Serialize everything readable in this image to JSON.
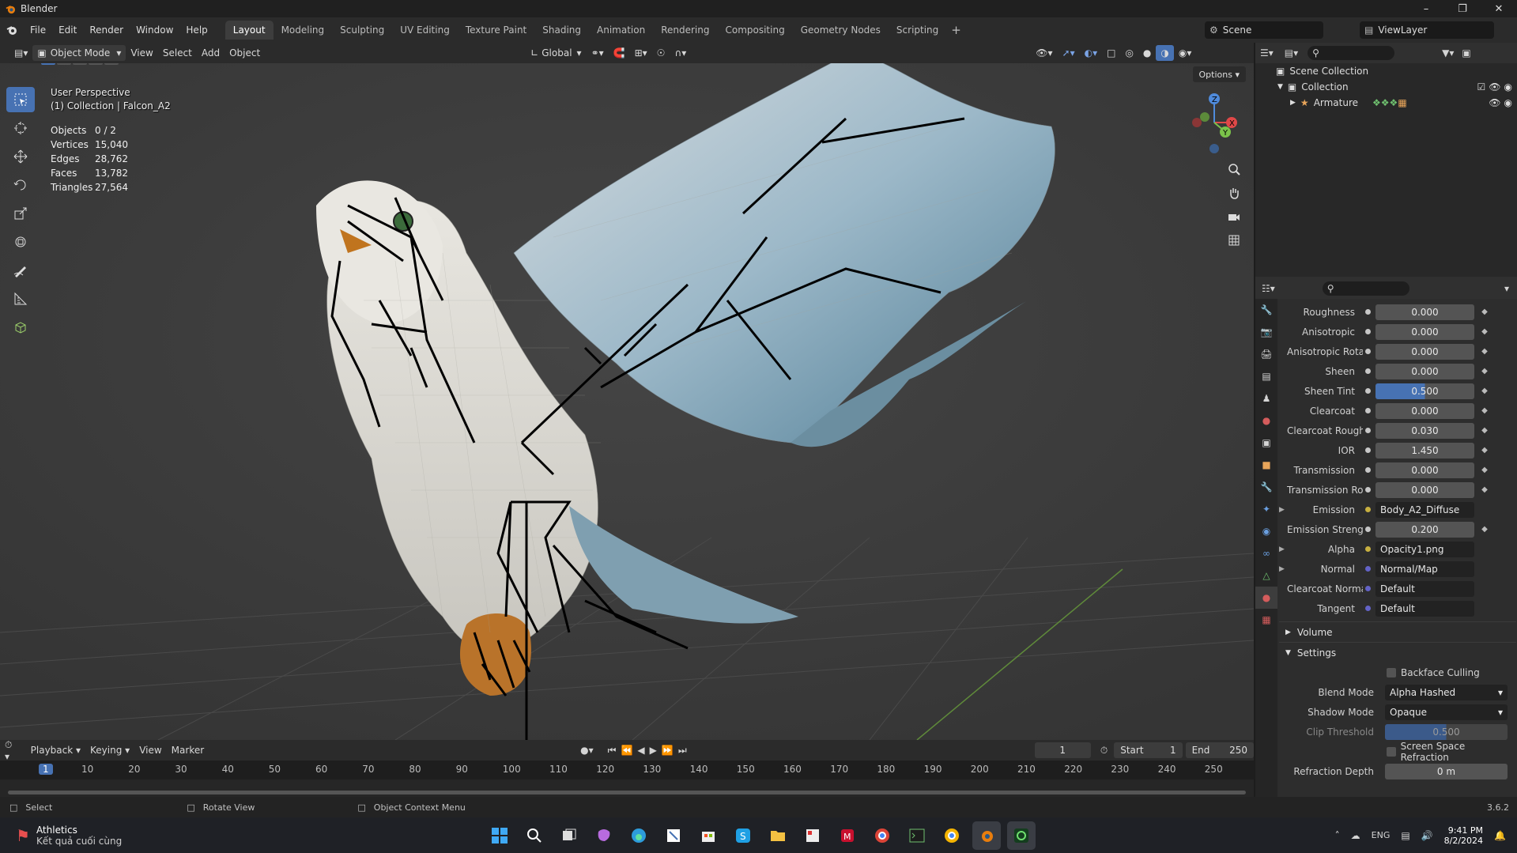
{
  "app": {
    "title": "Blender",
    "version": "3.6.2"
  },
  "menu": [
    "File",
    "Edit",
    "Render",
    "Window",
    "Help"
  ],
  "workspaces": [
    {
      "label": "Layout",
      "active": true
    },
    {
      "label": "Modeling"
    },
    {
      "label": "Sculpting"
    },
    {
      "label": "UV Editing"
    },
    {
      "label": "Texture Paint"
    },
    {
      "label": "Shading"
    },
    {
      "label": "Animation"
    },
    {
      "label": "Rendering"
    },
    {
      "label": "Compositing"
    },
    {
      "label": "Geometry Nodes"
    },
    {
      "label": "Scripting"
    }
  ],
  "scene": {
    "name": "Scene",
    "view_layer": "ViewLayer"
  },
  "viewport_header": {
    "mode": "Object Mode",
    "view": "View",
    "select": "Select",
    "add": "Add",
    "object": "Object",
    "orientation": "Global",
    "options": "Options"
  },
  "viewport": {
    "perspective": "User Perspective",
    "collection": "(1) Collection | Falcon_A2",
    "stats": [
      {
        "k": "Objects",
        "v": "0 / 2"
      },
      {
        "k": "Vertices",
        "v": "15,040"
      },
      {
        "k": "Edges",
        "v": "28,762"
      },
      {
        "k": "Faces",
        "v": "13,782"
      },
      {
        "k": "Triangles",
        "v": "27,564"
      }
    ],
    "gizmo": {
      "x": "X",
      "y": "Y",
      "z": "Z"
    }
  },
  "outliner": {
    "items": [
      {
        "label": "Scene Collection",
        "indent": 0
      },
      {
        "label": "Collection",
        "indent": 1
      },
      {
        "label": "Armature",
        "indent": 2
      }
    ]
  },
  "properties": {
    "rows": [
      {
        "label": "Roughness",
        "value": "0.000",
        "type": "num"
      },
      {
        "label": "Anisotropic",
        "value": "0.000",
        "type": "num"
      },
      {
        "label": "Anisotropic Rota...",
        "value": "0.000",
        "type": "num"
      },
      {
        "label": "Sheen",
        "value": "0.000",
        "type": "num"
      },
      {
        "label": "Sheen Tint",
        "value": "0.500",
        "type": "hl"
      },
      {
        "label": "Clearcoat",
        "value": "0.000",
        "type": "num"
      },
      {
        "label": "Clearcoat Rough...",
        "value": "0.030",
        "type": "num"
      },
      {
        "label": "IOR",
        "value": "1.450",
        "type": "num"
      },
      {
        "label": "Transmission",
        "value": "0.000",
        "type": "num"
      },
      {
        "label": "Transmission Ro...",
        "value": "0.000",
        "type": "num"
      },
      {
        "label": "Emission",
        "value": "Body_A2_Diffuse",
        "type": "link",
        "arrow": true,
        "dot": "#c8b040"
      },
      {
        "label": "Emission Strength",
        "value": "0.200",
        "type": "num"
      },
      {
        "label": "Alpha",
        "value": "Opacity1.png",
        "type": "link",
        "arrow": true,
        "dot": "#c8b040"
      },
      {
        "label": "Normal",
        "value": "Normal/Map",
        "type": "link",
        "arrow": true,
        "dot": "#6363c7"
      },
      {
        "label": "Clearcoat Normal",
        "value": "Default",
        "type": "link",
        "dot": "#6363c7"
      },
      {
        "label": "Tangent",
        "value": "Default",
        "type": "link",
        "dot": "#6363c7"
      }
    ],
    "volume": "Volume",
    "settings": "Settings",
    "backface": "Backface Culling",
    "blend_mode_label": "Blend Mode",
    "blend_mode": "Alpha Hashed",
    "shadow_mode_label": "Shadow Mode",
    "shadow_mode": "Opaque",
    "clip_label": "Clip Threshold",
    "clip": "0.500",
    "ssr": "Screen Space Refraction",
    "refraction_label": "Refraction Depth",
    "refraction": "0 m"
  },
  "timeline": {
    "playback": "Playback",
    "keying": "Keying",
    "view": "View",
    "marker": "Marker",
    "current": "1",
    "start_label": "Start",
    "start": "1",
    "end_label": "End",
    "end": "250",
    "ticks": [
      "1",
      "10",
      "20",
      "30",
      "40",
      "50",
      "60",
      "70",
      "80",
      "90",
      "100",
      "110",
      "120",
      "130",
      "140",
      "150",
      "160",
      "170",
      "180",
      "190",
      "200",
      "210",
      "220",
      "230",
      "240",
      "250"
    ]
  },
  "status": {
    "select": "Select",
    "rotate": "Rotate View",
    "context": "Object Context Menu"
  },
  "taskbar": {
    "weather_title": "Athletics",
    "weather_sub": "Kết quả cuối cùng",
    "lang": "ENG",
    "time": "9:41 PM",
    "date": "8/2/2024"
  },
  "colors": {
    "accent": "#4772b3",
    "bg": "#3d3d3d"
  }
}
